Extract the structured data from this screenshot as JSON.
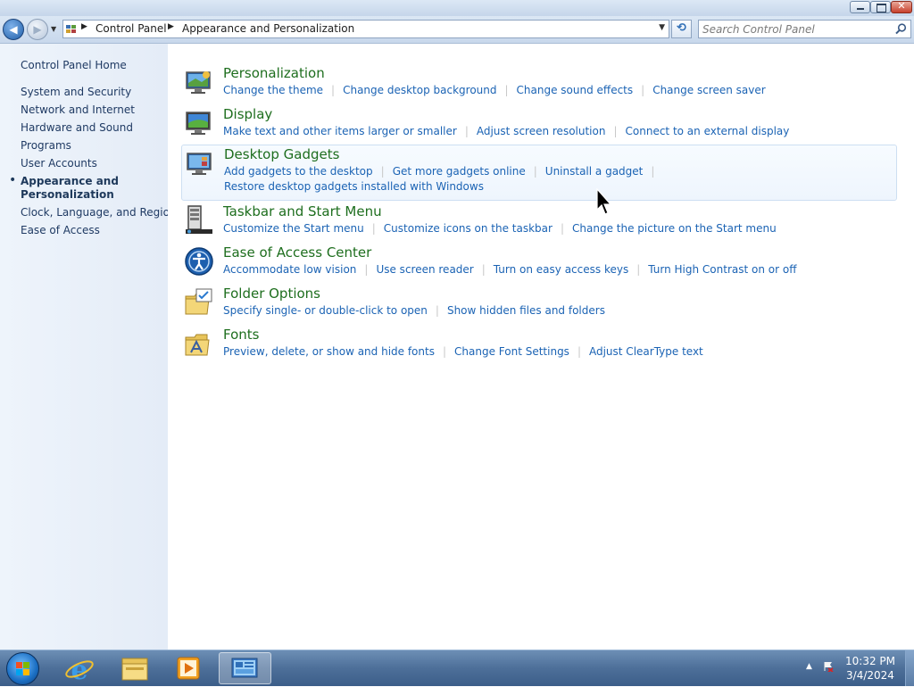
{
  "nav": {
    "back_glyph": "◀",
    "forward_glyph": "▶",
    "breadcrumbs": [
      "Control Panel",
      "Appearance and Personalization"
    ],
    "refresh_glyph": "⟲",
    "search_placeholder": "Search Control Panel"
  },
  "window": {
    "close_glyph": "✕"
  },
  "sidebar": {
    "home": "Control Panel Home",
    "items": [
      "System and Security",
      "Network and Internet",
      "Hardware and Sound",
      "Programs",
      "User Accounts"
    ],
    "current_line1": "Appearance and",
    "current_line2": "Personalization",
    "items_after": [
      "Clock, Language, and Region",
      "Ease of Access"
    ]
  },
  "categories": [
    {
      "title": "Personalization",
      "icon": "personalization-icon",
      "links": [
        "Change the theme",
        "Change desktop background",
        "Change sound effects",
        "Change screen saver"
      ]
    },
    {
      "title": "Display",
      "icon": "display-icon",
      "links": [
        "Make text and other items larger or smaller",
        "Adjust screen resolution",
        "Connect to an external display"
      ]
    },
    {
      "title": "Desktop Gadgets",
      "icon": "gadgets-icon",
      "links": [
        "Add gadgets to the desktop",
        "Get more gadgets online",
        "Uninstall a gadget"
      ],
      "links2": [
        "Restore desktop gadgets installed with Windows"
      ]
    },
    {
      "title": "Taskbar and Start Menu",
      "icon": "taskbar-icon",
      "links": [
        "Customize the Start menu",
        "Customize icons on the taskbar",
        "Change the picture on the Start menu"
      ]
    },
    {
      "title": "Ease of Access Center",
      "icon": "ease-of-access-icon",
      "links": [
        "Accommodate low vision",
        "Use screen reader",
        "Turn on easy access keys",
        "Turn High Contrast on or off"
      ]
    },
    {
      "title": "Folder Options",
      "icon": "folder-options-icon",
      "links": [
        "Specify single- or double-click to open",
        "Show hidden files and folders"
      ]
    },
    {
      "title": "Fonts",
      "icon": "fonts-icon",
      "links": [
        "Preview, delete, or show and hide fonts",
        "Change Font Settings",
        "Adjust ClearType text"
      ]
    }
  ],
  "taskbar": {
    "time": "10:32 PM",
    "date": "3/4/2024",
    "tray_arrow": "▲"
  },
  "colors": {
    "category_title": "#1e6e1e",
    "link": "#1b63b4",
    "sidebar_text": "#1f3a63"
  }
}
